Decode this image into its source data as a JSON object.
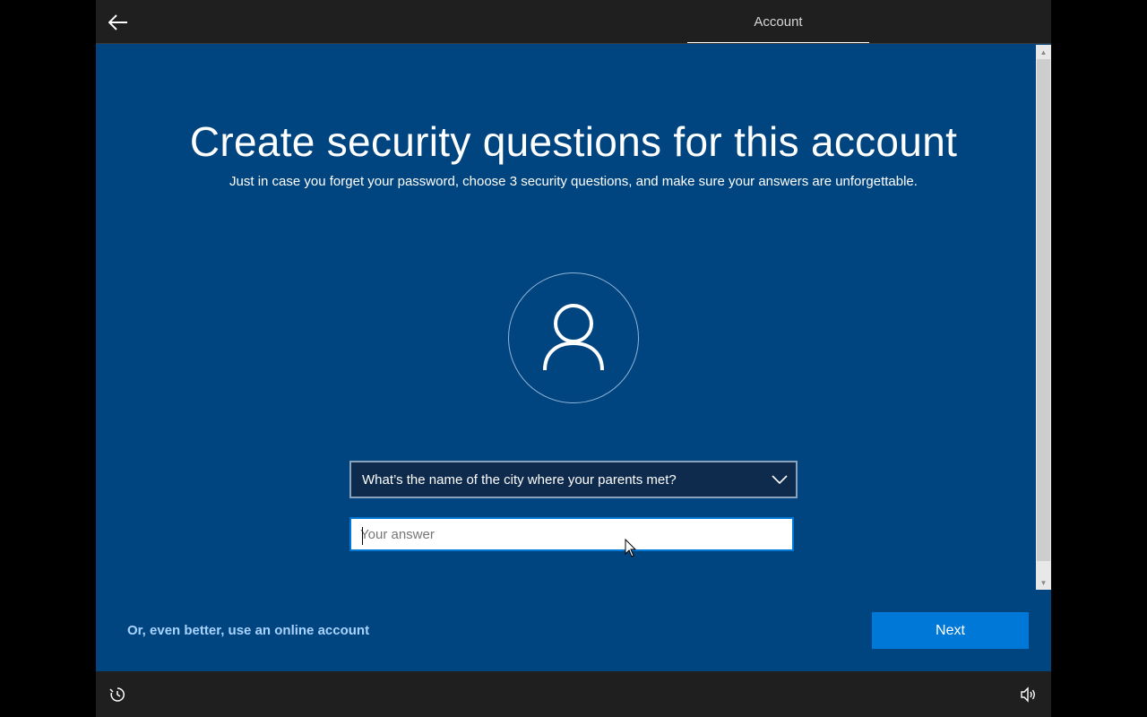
{
  "header": {
    "back_label": "Back",
    "tab_label": "Account"
  },
  "main": {
    "title": "Create security questions for this account",
    "subtitle": "Just in case you forget your password, choose 3 security questions, and make sure your answers are unforgettable.",
    "question": "What’s the name of the city where your parents met?",
    "answer_placeholder": "Your answer",
    "answer_value": "",
    "online_link": "Or, even better, use an online account",
    "next_label": "Next"
  },
  "icons": {
    "back": "arrow-left-icon",
    "avatar": "user-icon",
    "dropdown": "chevron-down-icon",
    "ease_of_access": "ease-of-access-icon",
    "volume": "speaker-icon",
    "cursor": "mouse-pointer-icon"
  },
  "colors": {
    "background": "#00457f",
    "accent": "#0078d7",
    "link": "#a9d3ff",
    "bar": "#1f1f1f"
  }
}
